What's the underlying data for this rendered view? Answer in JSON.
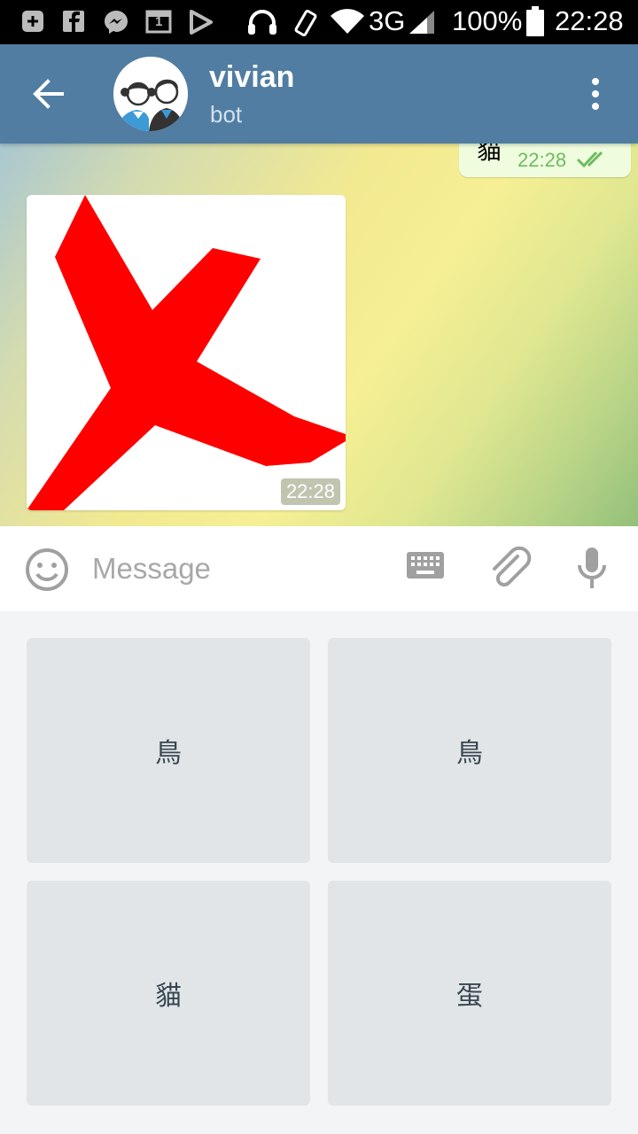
{
  "status_bar": {
    "network": "3G",
    "battery": "100%",
    "time": "22:28",
    "calendar_day": "1",
    "icons": [
      "add-icon",
      "facebook-icon",
      "messenger-icon",
      "calendar-icon",
      "play-icon",
      "headset-icon",
      "rotate-icon",
      "wifi-icon",
      "signal-icon",
      "battery-icon"
    ]
  },
  "header": {
    "title": "vivian",
    "subtitle": "bot",
    "color": "#517da2"
  },
  "chat": {
    "outgoing": {
      "text": "貓",
      "time": "22:28",
      "status_icon": "double-check-icon"
    },
    "incoming_photo": {
      "time": "22:28",
      "image": "red-x-mark"
    }
  },
  "input": {
    "placeholder": "Message",
    "value": ""
  },
  "bot_keyboard": {
    "buttons": [
      {
        "label": "鳥"
      },
      {
        "label": "鳥"
      },
      {
        "label": "貓"
      },
      {
        "label": "蛋"
      }
    ]
  }
}
